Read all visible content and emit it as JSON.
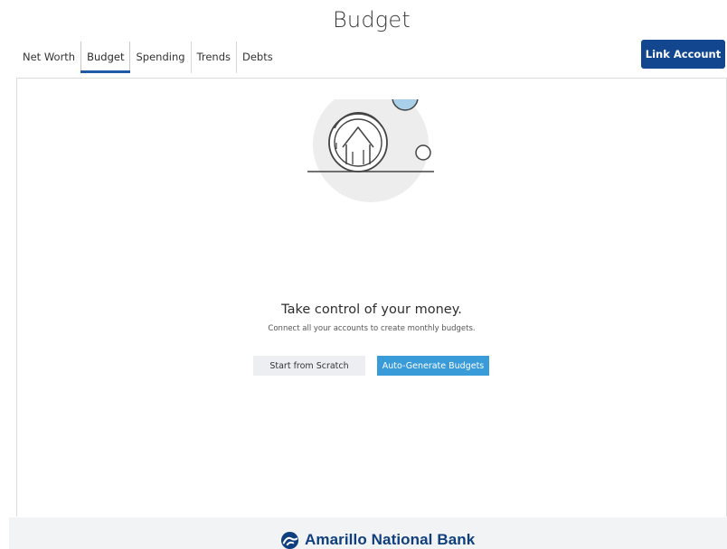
{
  "header": {
    "title": "Budget"
  },
  "tabs": [
    {
      "label": "Net Worth",
      "active": false
    },
    {
      "label": "Budget",
      "active": true
    },
    {
      "label": "Spending",
      "active": false
    },
    {
      "label": "Trends",
      "active": false
    },
    {
      "label": "Debts",
      "active": false
    }
  ],
  "actions": {
    "link_account_label": "Link Account"
  },
  "empty_state": {
    "icon": "house-in-coin-icon",
    "headline": "Take control of your money.",
    "subtext": "Connect all your accounts to create monthly budgets.",
    "start_scratch_label": "Start from Scratch",
    "auto_generate_label": "Auto-Generate Budgets"
  },
  "footer": {
    "brand_name": "Amarillo National Bank",
    "logo_icon": "anb-logo-icon"
  },
  "colors": {
    "primary": "#12468f",
    "accent": "#3a9bd9",
    "tab_indicator": "#1f5aa6",
    "secondary_button": "#eceef2",
    "footer_bg": "#f2f3f4"
  }
}
